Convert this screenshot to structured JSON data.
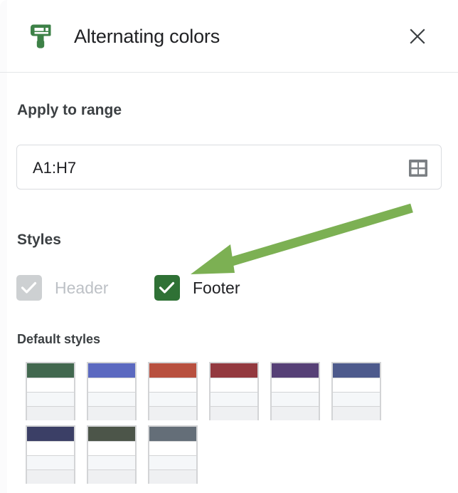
{
  "dialog": {
    "title": "Alternating colors",
    "brush_icon": "paint-brush-icon",
    "close_icon": "close-icon"
  },
  "apply_to_range": {
    "label": "Apply to range",
    "value": "A1:H7",
    "placeholder": "A1:H7",
    "grid_icon": "select-data-range-grid-icon"
  },
  "styles": {
    "label": "Styles",
    "checkboxes": [
      {
        "label": "Header",
        "checked": true,
        "disabled": true,
        "color": "#cdd0d2"
      },
      {
        "label": "Footer",
        "checked": true,
        "disabled": false,
        "color": "#2f7135"
      }
    ]
  },
  "default_styles": {
    "label": "Default styles",
    "swatches": [
      {
        "name": "green",
        "color": "#42684f"
      },
      {
        "name": "blue-violet",
        "color": "#5b69c0"
      },
      {
        "name": "red",
        "color": "#b8503f"
      },
      {
        "name": "dark-red",
        "color": "#93393f"
      },
      {
        "name": "purple",
        "color": "#564076"
      },
      {
        "name": "indigo",
        "color": "#4d5a8c"
      },
      {
        "name": "navy",
        "color": "#3b3f66"
      },
      {
        "name": "dark-olive",
        "color": "#4c5549"
      },
      {
        "name": "slate-gray",
        "color": "#646e78"
      }
    ],
    "row_colors": {
      "row1": "#ffffff",
      "row2": "#f5f7f9",
      "row3": "#eff0f2",
      "border": "#d3d4d6"
    }
  },
  "annotation": {
    "name": "green-arrow-pointing-to-footer-checkbox",
    "color": "#7cb053"
  }
}
